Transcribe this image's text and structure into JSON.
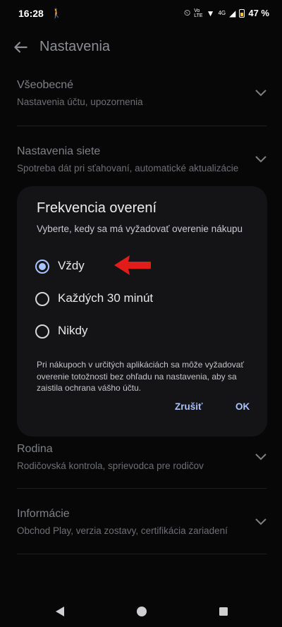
{
  "status_bar": {
    "time": "16:28",
    "network_label": "4G",
    "battery": "47 %"
  },
  "app_bar": {
    "title": "Nastavenia"
  },
  "settings": [
    {
      "title": "Všeobecné",
      "subtitle": "Nastavenia účtu, upozornenia"
    },
    {
      "title": "Nastavenia siete",
      "subtitle": "Spotreba dát pri sťahovaní, automatické aktualizácie"
    },
    {
      "title": "Rodina",
      "subtitle": "Rodičovská kontrola, sprievodca pre rodičov"
    },
    {
      "title": "Informácie",
      "subtitle": "Obchod Play, verzia zostavy, certifikácia zariadení"
    }
  ],
  "dialog": {
    "title": "Frekvencia overení",
    "subtitle": "Vyberte, kedy sa má vyžadovať overenie nákupu",
    "options": [
      {
        "label": "Vždy",
        "selected": true
      },
      {
        "label": "Každých 30 minút",
        "selected": false
      },
      {
        "label": "Nikdy",
        "selected": false
      }
    ],
    "note": "Pri nákupoch v určitých aplikáciách sa môže vyžadovať overenie totožnosti bez ohľadu na nastavenia, aby sa zaistila ochrana vášho účtu.",
    "cancel_label": "Zrušiť",
    "ok_label": "OK"
  },
  "colors": {
    "accent": "#a9c3ff",
    "annotation_arrow": "#e21b1b"
  }
}
